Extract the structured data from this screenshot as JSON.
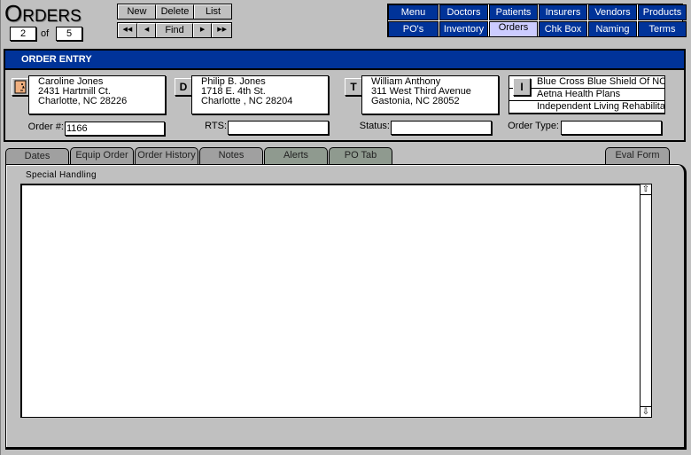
{
  "header": {
    "title_first": "O",
    "title_rest": "RDERS",
    "record_current": "2",
    "record_of": "of",
    "record_total": "5"
  },
  "toolbar": {
    "new_label": "New",
    "delete_label": "Delete",
    "list_label": "List",
    "first_label": "◀◀",
    "prev_label": "◀",
    "find_label": "Find",
    "next_label": "▶",
    "last_label": "▶▶"
  },
  "nav": {
    "row1": [
      "Menu",
      "Doctors",
      "Patients",
      "Insurers",
      "Vendors",
      "Products"
    ],
    "row2": [
      "PO's",
      "Inventory",
      "Orders",
      "Chk Box",
      "Naming",
      "Terms"
    ],
    "active": "Orders"
  },
  "order_entry": {
    "title": "ORDER ENTRY",
    "patient": {
      "icon": "face-icon",
      "lines": [
        "Caroline Jones",
        "2431 Hartmill Ct.",
        "Charlotte, NC 28226"
      ]
    },
    "doctor": {
      "tag": "D",
      "lines": [
        "Philip B. Jones",
        "1718 E. 4th St.",
        "Charlotte , NC 28204"
      ]
    },
    "therapist": {
      "tag": "T",
      "lines": [
        "William Anthony",
        "311 West Third Avenue",
        "Gastonia, NC 28052"
      ]
    },
    "insurer": {
      "tag": "I",
      "items": [
        "Blue Cross Blue Shield Of NC",
        "Aetna Health Plans",
        "Independent Living Rehabilitation Program"
      ]
    },
    "fields": {
      "order_no_label": "Order #:",
      "order_no_value": "1166",
      "rts_label": "RTS:",
      "rts_value": "",
      "status_label": "Status:",
      "status_value": "",
      "order_type_label": "Order Type:",
      "order_type_value": ""
    }
  },
  "tabs": [
    "Dates",
    "Equip Order",
    "Order History",
    "Notes",
    "Alerts",
    "PO Tab",
    "Eval Form"
  ],
  "special_handling": {
    "label": "Special Handling",
    "value": ""
  },
  "colors": {
    "nav_blue": "#003399",
    "nav_active": "#ccccff",
    "face_icon": "#f0b080"
  }
}
